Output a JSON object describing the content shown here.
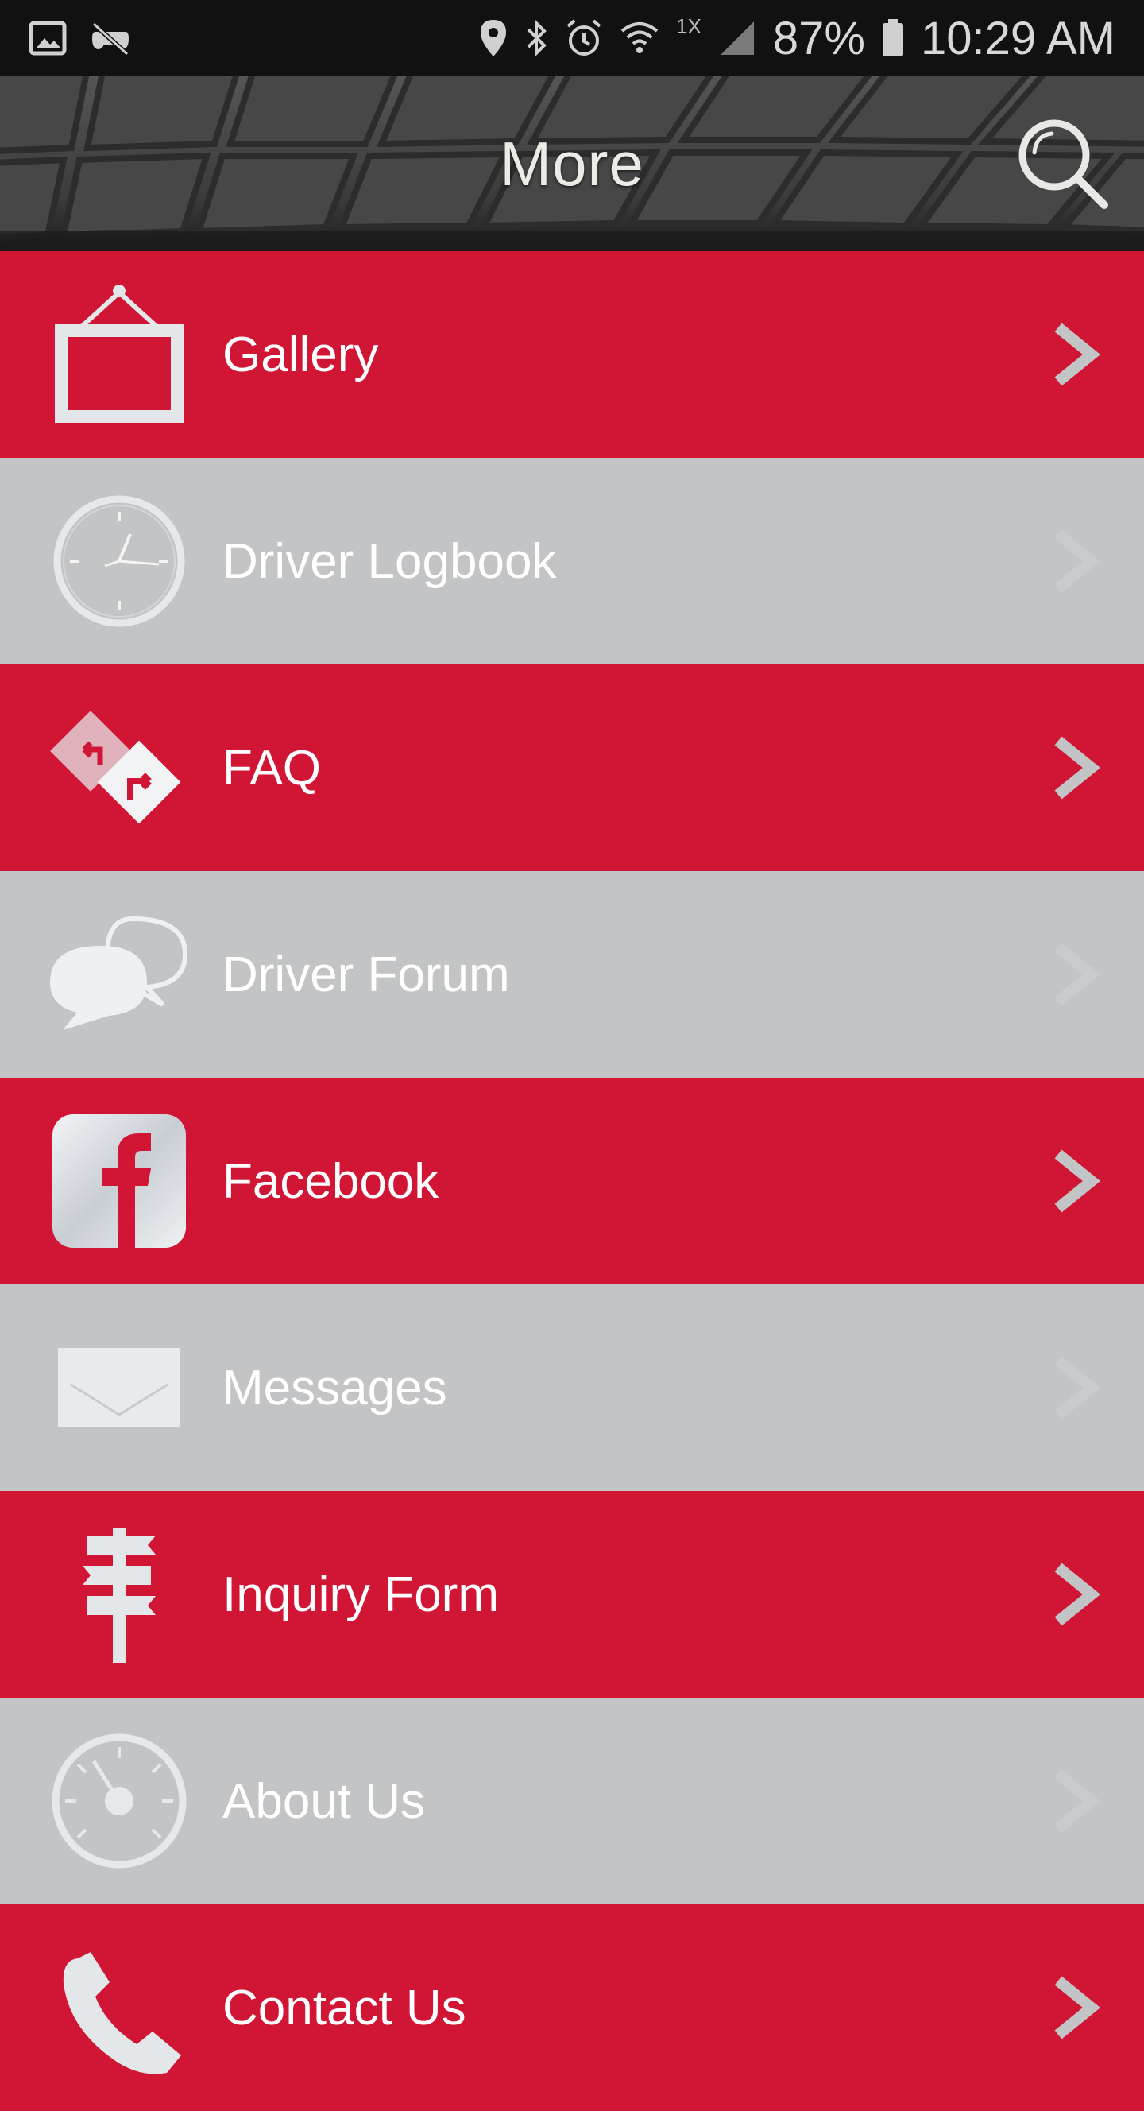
{
  "status_bar": {
    "network_label": "1X",
    "battery_percent": "87%",
    "time": "10:29 AM"
  },
  "header": {
    "title": "More"
  },
  "colors": {
    "red_row": "#d01535",
    "gray_row": "#c3c4c6",
    "icon_light": "#e6e9ec",
    "chevron_on_red": "#c3c4c6"
  },
  "menu": {
    "items": [
      {
        "label": "Gallery",
        "icon": "picture-frame-icon",
        "style": "red"
      },
      {
        "label": "Driver Logbook",
        "icon": "clock-icon",
        "style": "gray"
      },
      {
        "label": "FAQ",
        "icon": "direction-signs-icon",
        "style": "red"
      },
      {
        "label": "Driver Forum",
        "icon": "chat-bubbles-icon",
        "style": "gray"
      },
      {
        "label": "Facebook",
        "icon": "facebook-icon",
        "style": "red"
      },
      {
        "label": "Messages",
        "icon": "envelope-icon",
        "style": "gray"
      },
      {
        "label": "Inquiry Form",
        "icon": "signpost-icon",
        "style": "red"
      },
      {
        "label": "About Us",
        "icon": "speedometer-icon",
        "style": "gray"
      },
      {
        "label": "Contact Us",
        "icon": "phone-icon",
        "style": "red"
      }
    ]
  }
}
